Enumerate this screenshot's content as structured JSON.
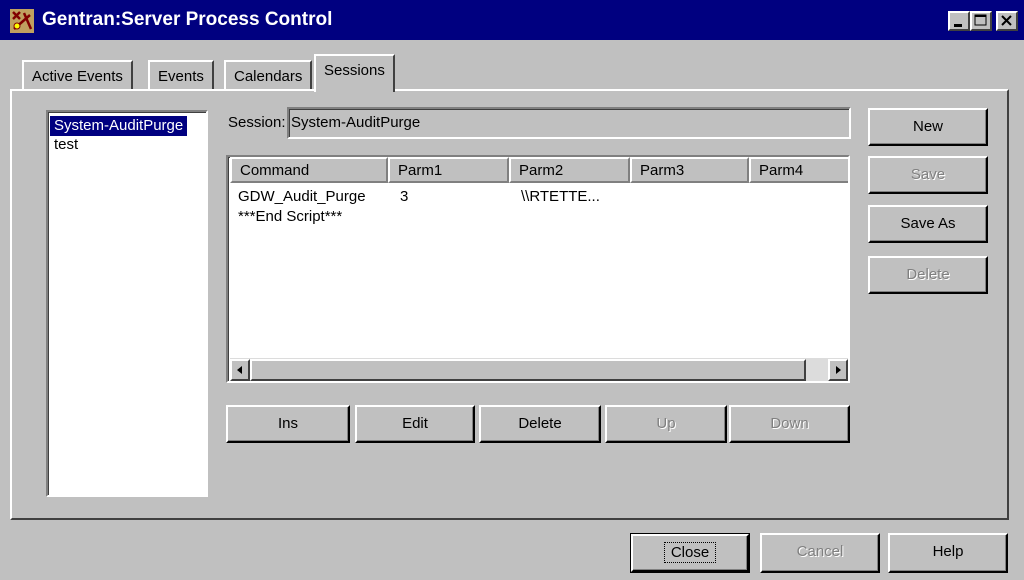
{
  "window": {
    "title": "Gentran:Server Process Control",
    "icon": "app-icon",
    "controls": [
      "minimize-icon",
      "maximize-icon",
      "close-icon"
    ]
  },
  "tabs": [
    {
      "label": "Active Events"
    },
    {
      "label": "Events"
    },
    {
      "label": "Calendars"
    },
    {
      "label": "Sessions",
      "active": true
    }
  ],
  "sessions_list": [
    {
      "label": "System-AuditPurge",
      "selected": true
    },
    {
      "label": "test"
    }
  ],
  "session": {
    "label": "Session:",
    "value": "System-AuditPurge"
  },
  "grid": {
    "columns": [
      "Command",
      "Parm1",
      "Parm2",
      "Parm3",
      "Parm4"
    ],
    "rows": [
      [
        "GDW_Audit_Purge",
        "3",
        "\\\\RTETTE...",
        "",
        ""
      ],
      [
        "***End Script***",
        "",
        "",
        "",
        ""
      ]
    ]
  },
  "grid_buttons": {
    "ins": "Ins",
    "edit": "Edit",
    "delete": "Delete",
    "up": "Up",
    "down": "Down"
  },
  "side_buttons": {
    "new": "New",
    "save": "Save",
    "save_as": "Save As",
    "delete": "Delete"
  },
  "footer_buttons": {
    "close": "Close",
    "cancel": "Cancel",
    "help": "Help"
  },
  "colors": {
    "titlebar": "#000080",
    "face": "#c0c0c0",
    "selection": "#000080",
    "disabled_text": "#808080"
  }
}
